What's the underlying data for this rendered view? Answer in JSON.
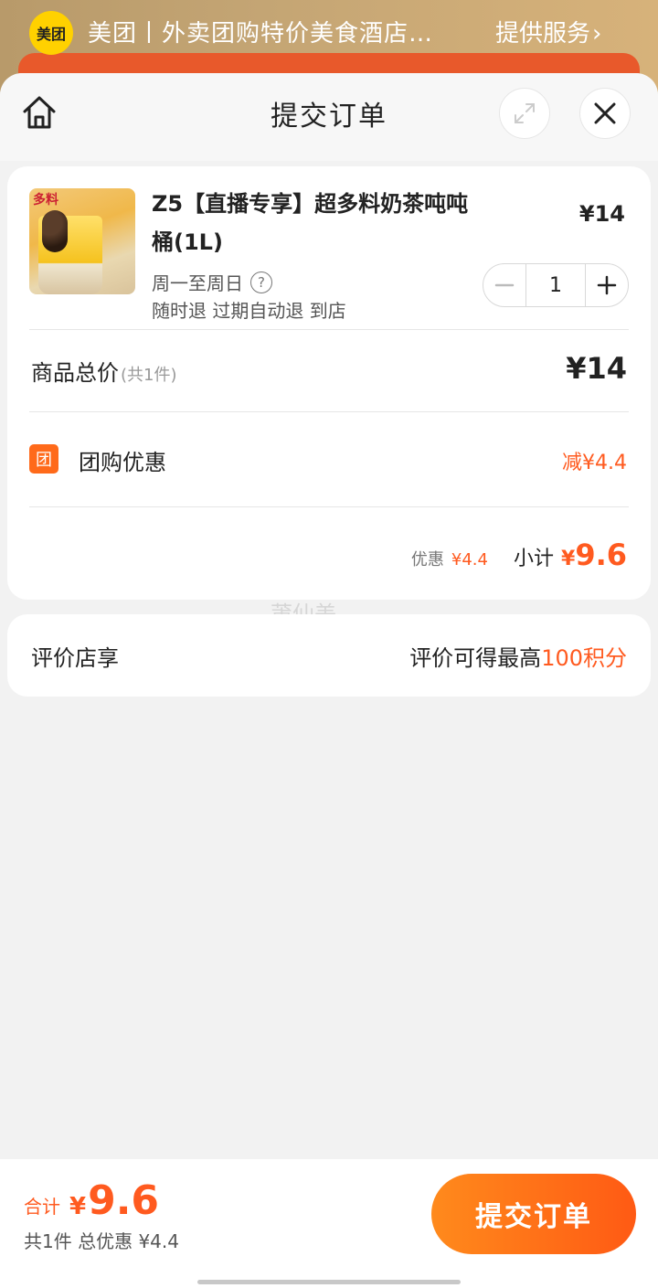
{
  "banner": {
    "logo_text": "美团",
    "title": "美团丨外卖团购特价美食酒店…",
    "service_label": "提供服务",
    "service_chevron": "›"
  },
  "header": {
    "title": "提交订单",
    "home_icon": "home-icon",
    "expand_icon": "expand-icon",
    "close_icon": "close-icon"
  },
  "item": {
    "name": "Z5【直播专享】超多料奶茶吨吨桶(1L)",
    "price": "¥14",
    "validity": "周一至周日",
    "help_icon": "?",
    "policy": "随时退 过期自动退 到店",
    "quantity": "1",
    "image_caption": "多料"
  },
  "totals": {
    "goods_label": "商品总价",
    "goods_count": "(共1件)",
    "goods_value": "¥14",
    "promo_icon_text": "团",
    "promo_label": "团购优惠",
    "promo_value": "减¥4.4",
    "discount_label": "优惠",
    "discount_value": "¥4.4",
    "subtotal_label": "小计",
    "subtotal_yen": "¥",
    "subtotal_value": "9.6"
  },
  "watermark": "莆仙美",
  "review": {
    "label": "评价店享",
    "prefix": "评价可得最高",
    "points": "100积分"
  },
  "footer": {
    "total_label": "合计",
    "total_yen": "¥",
    "total_value": "9.6",
    "summary": "共1件 总优惠 ¥4.4",
    "submit_label": "提交订单"
  },
  "colors": {
    "accent": "#ff5a1f",
    "button_start": "#ff8a1c",
    "button_end": "#ff5a14",
    "brand_yellow": "#ffd100"
  }
}
